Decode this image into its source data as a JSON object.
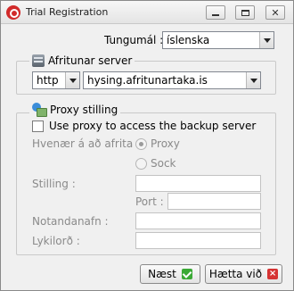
{
  "window": {
    "title": "Trial Registration",
    "icons": {
      "app": "app-logo-icon",
      "minimize": "minimize-icon",
      "maximize": "maximize-icon",
      "close": "close-icon"
    }
  },
  "language": {
    "label": "Tungumál :",
    "selected": "íslenska"
  },
  "server": {
    "legend": "Afritunar server",
    "icon": "server-icon",
    "protocol": "http",
    "host": "hysing.afritunartaka.is"
  },
  "proxy": {
    "legend": "Proxy stilling",
    "icon": "proxy-icon",
    "use_proxy_label": "Use proxy to access the backup server",
    "use_proxy_checked": false,
    "when_label": "Hvenær á að afrita :",
    "options": [
      "Proxy",
      "Sock"
    ],
    "selected_option": "Proxy",
    "setting_label": "Stilling :",
    "setting_value": "",
    "port_label": "Port :",
    "port_value": "",
    "username_label": "Notandanafn :",
    "username_value": "",
    "password_label": "Lykilorð :",
    "password_value": ""
  },
  "buttons": {
    "next_label": "Næst",
    "cancel_label": "Hætta við"
  }
}
